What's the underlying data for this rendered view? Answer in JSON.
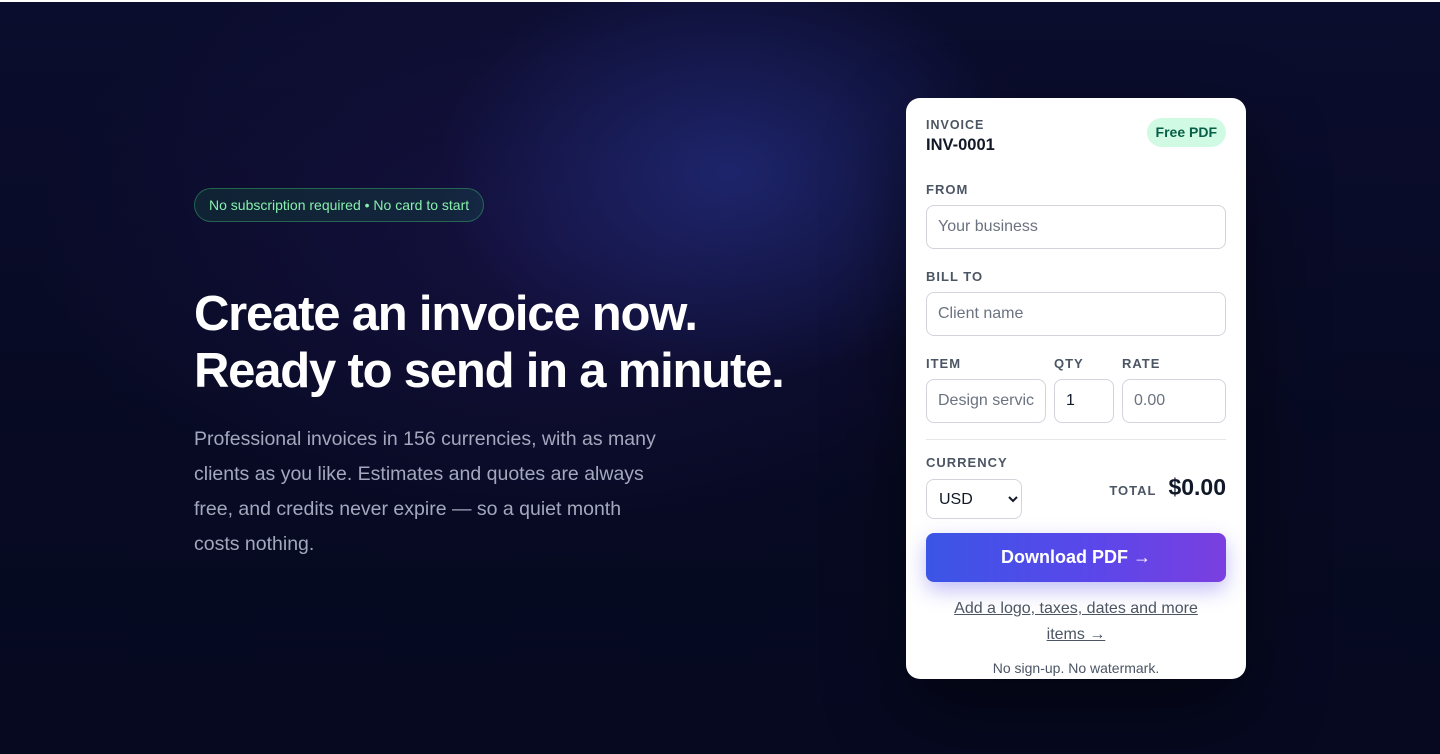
{
  "hero": {
    "badge": "No subscription required • No card to start",
    "headline_line1": "Create an invoice now.",
    "headline_line2": "Ready to send in a minute.",
    "subcopy": "Professional invoices in 156 currencies, with as many clients as you like. Estimates and quotes are always free, and credits never expire — so a quiet month costs nothing."
  },
  "card": {
    "invoice_label": "INVOICE",
    "invoice_number": "INV-0001",
    "badge": "Free PDF",
    "from_label": "FROM",
    "from_placeholder": "Your business",
    "bill_to_label": "BILL TO",
    "bill_to_placeholder": "Client name",
    "item_label": "ITEM",
    "item_placeholder": "Design services",
    "qty_label": "QTY",
    "qty_value": "1",
    "rate_label": "RATE",
    "rate_placeholder": "0.00",
    "currency_label": "CURRENCY",
    "currency_value": "USD",
    "total_label": "TOTAL",
    "total_amount": "$0.00",
    "download_label": "Download PDF →",
    "more_link": "Add a logo, taxes, dates and more items →",
    "footnote": "No sign-up. No watermark."
  },
  "colors": {
    "background": "#070b24",
    "accent_start": "#3b55e6",
    "accent_end": "#7a3fe0",
    "badge_green": "#86efac"
  }
}
